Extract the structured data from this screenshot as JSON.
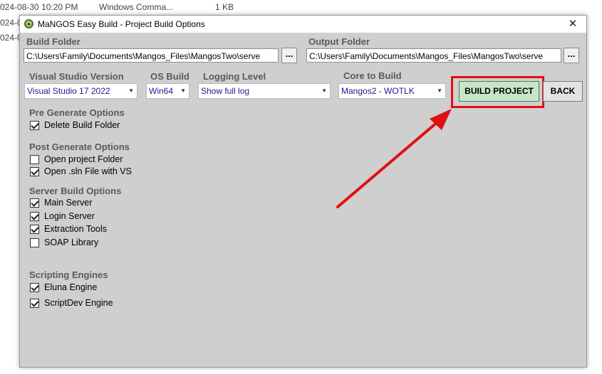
{
  "background": {
    "date": "024-08-30 10:20 PM",
    "type": "Windows Comma...",
    "size": "1 KB",
    "cut1": "024-0",
    "cut2": "024-0"
  },
  "window": {
    "title": "MaNGOS Easy Build - Project Build Options",
    "close_label": "✕"
  },
  "build_folder": {
    "label": "Build Folder",
    "value": "C:\\Users\\Family\\Documents\\Mangos_Files\\MangosTwo\\serve",
    "browse_label": "..."
  },
  "output_folder": {
    "label": "Output Folder",
    "value": "C:\\Users\\Family\\Documents\\Mangos_Files\\MangosTwo\\serve",
    "browse_label": "..."
  },
  "selects": {
    "vs_version": {
      "label": "Visual Studio Version",
      "value": "Visual Studio 17 2022"
    },
    "os_build": {
      "label": "OS Build",
      "value": "Win64"
    },
    "logging": {
      "label": "Logging Level",
      "value": "Show full log"
    },
    "core": {
      "label": "Core to Build",
      "value": "Mangos2 - WOTLK"
    }
  },
  "buttons": {
    "build": "BUILD PROJECT",
    "back": "BACK"
  },
  "pre_generate": {
    "title": "Pre Generate Options",
    "items": [
      {
        "label": "Delete Build Folder",
        "checked": true
      }
    ]
  },
  "post_generate": {
    "title": "Post Generate Options",
    "items": [
      {
        "label": "Open project Folder",
        "checked": false
      },
      {
        "label": "Open .sln File with VS",
        "checked": true
      }
    ]
  },
  "server_build": {
    "title": "Server Build Options",
    "items": [
      {
        "label": "Main Server",
        "checked": true
      },
      {
        "label": "Login Server",
        "checked": true
      },
      {
        "label": "Extraction Tools",
        "checked": true
      },
      {
        "label": "SOAP Library",
        "checked": false
      }
    ]
  },
  "scripting": {
    "title": "Scripting Engines",
    "items": [
      {
        "label": "Eluna Engine",
        "checked": true
      },
      {
        "label": "ScriptDev Engine",
        "checked": true
      }
    ]
  },
  "annotation": {
    "arrow_color": "#e01010",
    "highlight_color": "#e01010"
  }
}
